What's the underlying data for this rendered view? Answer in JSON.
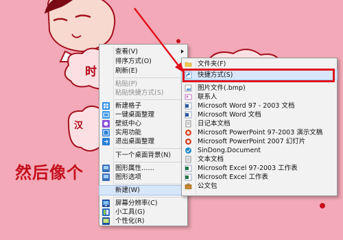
{
  "background": {
    "cloud_text_1": "时",
    "cloud_text_2": "汉",
    "caption": "然后像个"
  },
  "context_menu": {
    "items": [
      {
        "label": "查看(V)",
        "submenu": true
      },
      {
        "label": "排序方式(O)",
        "submenu": true
      },
      {
        "label": "刷新(E)"
      },
      {
        "label": "粘贴(P)",
        "disabled": true
      },
      {
        "label": "粘贴快捷方式(S)",
        "disabled": true
      },
      {
        "label": "新建格子",
        "icon": "grid-icon"
      },
      {
        "label": "一键桌面整理",
        "icon": "desktop-tidy-icon"
      },
      {
        "label": "壁纸中心",
        "icon": "wallpaper-icon"
      },
      {
        "label": "实用功能",
        "icon": "tools-icon",
        "submenu": true
      },
      {
        "label": "退出桌面整理",
        "icon": "exit-icon"
      },
      {
        "label": "下一个桌面背景(N)"
      },
      {
        "label": "图形属性……",
        "icon": "graphics-properties-icon"
      },
      {
        "label": "图形选项",
        "icon": "graphics-options-icon",
        "submenu": true
      },
      {
        "label": "新建(W)",
        "submenu": true
      },
      {
        "label": "屏幕分辨率(C)",
        "icon": "display-icon"
      },
      {
        "label": "小工具(G)",
        "icon": "gadgets-icon"
      },
      {
        "label": "个性化(R)",
        "icon": "personalize-icon"
      }
    ]
  },
  "new_submenu": {
    "items": [
      {
        "label": "文件夹(F)",
        "icon": "folder-icon"
      },
      {
        "label": "快捷方式(S)",
        "icon": "shortcut-icon"
      },
      {
        "label": "图片文件(.bmp)",
        "icon": "bitmap-icon"
      },
      {
        "label": "联系人",
        "icon": "contact-icon"
      },
      {
        "label": "Microsoft Word 97 - 2003 文档",
        "icon": "word-icon"
      },
      {
        "label": "Microsoft Word 文档",
        "icon": "word-icon"
      },
      {
        "label": "日记本文档",
        "icon": "journal-icon"
      },
      {
        "label": "Microsoft PowerPoint 97-2003 演示文稿",
        "icon": "powerpoint-icon"
      },
      {
        "label": "Microsoft PowerPoint 2007 幻灯片",
        "icon": "powerpoint-icon"
      },
      {
        "label": "SinDong.Document",
        "icon": "sindong-icon"
      },
      {
        "label": "文本文档",
        "icon": "text-document-icon"
      },
      {
        "label": "Microsoft Excel 97-2003 工作表",
        "icon": "excel-icon"
      },
      {
        "label": "Microsoft Excel 工作表",
        "icon": "excel-icon"
      },
      {
        "label": "公文包",
        "icon": "briefcase-icon"
      }
    ]
  },
  "colors": {
    "accent_red": "#e0101c",
    "menu_bg": "#f2f2f2",
    "highlight": "#d7e6f9"
  }
}
